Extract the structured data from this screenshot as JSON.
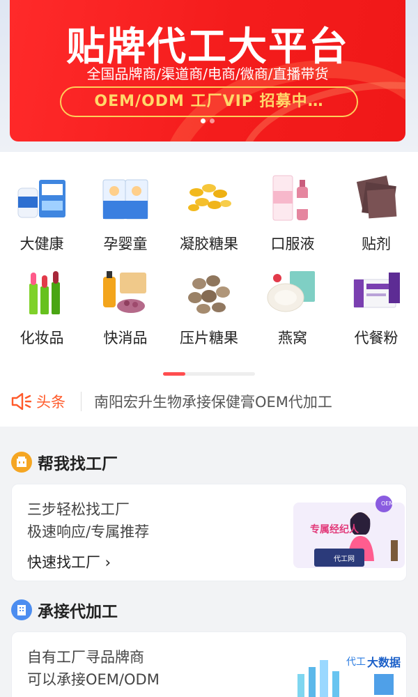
{
  "banner": {
    "title": "贴牌代工大平台",
    "subtitle": "全国品牌商/渠道商/电商/微商/直播带货",
    "pill": "OEM/ODM 工厂VIP 招募中…"
  },
  "categories": [
    {
      "label": "大健康",
      "icon": "health-product-icon"
    },
    {
      "label": "孕婴童",
      "icon": "baby-product-icon"
    },
    {
      "label": "凝胶糖果",
      "icon": "softgel-icon"
    },
    {
      "label": "口服液",
      "icon": "oral-liquid-icon"
    },
    {
      "label": "贴剂",
      "icon": "patch-icon"
    },
    {
      "label": "化妆品",
      "icon": "cosmetics-icon"
    },
    {
      "label": "快消品",
      "icon": "fmcg-icon"
    },
    {
      "label": "压片糖果",
      "icon": "tablet-candy-icon"
    },
    {
      "label": "燕窝",
      "icon": "birds-nest-icon"
    },
    {
      "label": "代餐粉",
      "icon": "meal-powder-icon"
    }
  ],
  "headline": {
    "tag": "头条",
    "text": "南阳宏升生物承接保健膏OEM代加工"
  },
  "find_factory": {
    "title": "帮我找工厂",
    "line1": "三步轻松找工厂",
    "line2": "极速响应/专属推荐",
    "link": "快速找工厂 ›",
    "badge": "专属经纪人",
    "oem_badge": "OEM",
    "desk_label": "代工网"
  },
  "contract": {
    "title": "承接代加工",
    "line1": "自有工厂寻品牌商",
    "line2": "可以承接OEM/ODM",
    "badge_a": "代工",
    "badge_b": "大数据"
  },
  "colors": {
    "brand_red": "#f41c1c",
    "accent_orange": "#ff5a2a",
    "gold": "#ffd86a"
  }
}
